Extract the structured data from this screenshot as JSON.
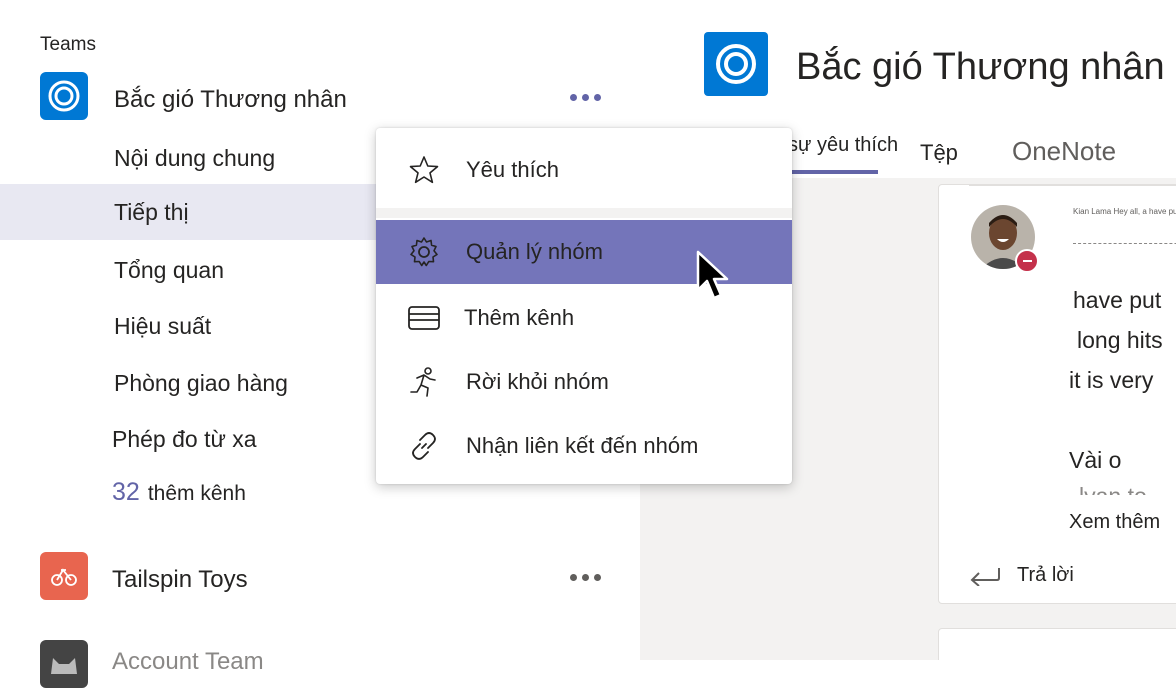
{
  "sidebar": {
    "section_label": "Teams",
    "teams": [
      {
        "name": "Bắc gió Thương nhân",
        "avatar_color": "#0078d4"
      },
      {
        "name": "Tailspin Toys",
        "avatar_color": "#e8654f"
      },
      {
        "name": "Account Team",
        "avatar_color": "#444444"
      }
    ],
    "channels": [
      "Nội dung chung",
      "Tiếp thị",
      "Tổng quan",
      "Hiệu suất",
      "Phòng giao hàng",
      "Phép đo từ xa"
    ],
    "more_channels": {
      "count": "32",
      "label": "thêm kênh"
    }
  },
  "menu": {
    "items": [
      {
        "label": "Yêu thích",
        "icon": "star-icon"
      },
      {
        "label": "Quản lý nhóm",
        "icon": "gear-icon"
      },
      {
        "label": "Thêm kênh",
        "icon": "channel-icon"
      },
      {
        "label": "Rời khỏi nhóm",
        "icon": "running-person-icon"
      },
      {
        "label": "Nhận liên kết đến nhóm",
        "icon": "link-icon"
      }
    ]
  },
  "header": {
    "title": "Bắc gió Thương nhân",
    "tabs": [
      "sự yêu thích",
      "Tệp",
      "OneNote"
    ]
  },
  "message": {
    "tiny_text": "Kian Lama Hey all, a have put",
    "lines": [
      "have put",
      "long hits",
      "it is very",
      "Vài o",
      "lyan to"
    ],
    "see_more": "Xem thêm",
    "reply": "Trả lời"
  },
  "colors": {
    "accent": "#6264a7",
    "menu_active": "#7475ba",
    "selected_channel": "#e8e8f2"
  }
}
